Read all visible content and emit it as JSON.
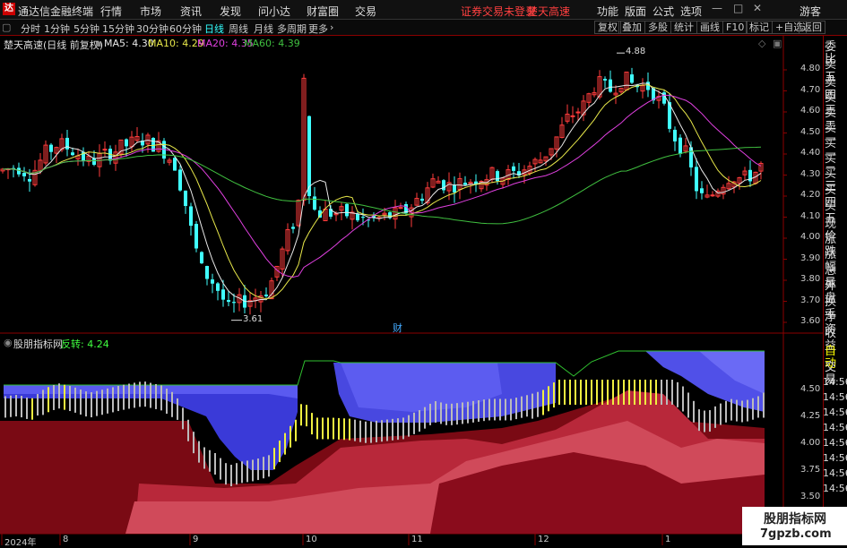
{
  "titlebar": {
    "logo": "达",
    "app_title": "通达信金融终端",
    "menus": [
      "行情",
      "市场",
      "资讯",
      "发现",
      "问小达",
      "财富圈",
      "交易"
    ],
    "warning": "证券交易未登录",
    "stock_name": "楚天高速",
    "right_menus": [
      "功能",
      "版面",
      "公式",
      "选项"
    ],
    "user": "游客"
  },
  "toolbar": {
    "periods": [
      "分时",
      "1分钟",
      "5分钟",
      "15分钟",
      "30分钟",
      "60分钟",
      "日线",
      "周线",
      "月线",
      "多周期",
      "更多"
    ],
    "active_period": "日线",
    "right_buttons": [
      "复权",
      "叠加",
      "多股",
      "统计",
      "画线",
      "F10",
      "标记",
      "+自选",
      "返回"
    ]
  },
  "main_chart": {
    "title": "楚天高速(日线 前复权)",
    "ma": [
      {
        "label": "MA5: 4.30",
        "color": "#e8e8e8"
      },
      {
        "label": "MA10: 4.29",
        "color": "#e8e84a"
      },
      {
        "label": "MA20: 4.35",
        "color": "#e040e0"
      },
      {
        "label": "MA60: 4.39",
        "color": "#40c040"
      }
    ],
    "high_label": "4.88",
    "low_label": "3.61",
    "event_label": "财",
    "y_ticks": [
      "4.80",
      "4.70",
      "4.60",
      "4.50",
      "4.40",
      "4.30",
      "4.20",
      "4.10",
      "4.00",
      "3.90",
      "3.80",
      "3.70",
      "3.60"
    ]
  },
  "sub_chart": {
    "title": "股朋指标网",
    "indicator": "反转: 4.24",
    "indicator_color": "#40ff40",
    "y_ticks": [
      "4.50",
      "4.25",
      "4.00",
      "3.75",
      "3.50"
    ]
  },
  "x_axis": [
    "2024年",
    "8",
    "9",
    "10",
    "11",
    "12",
    "1"
  ],
  "sidebar": [
    "委比",
    "卖五",
    "卖四",
    "卖三",
    "卖二",
    "卖一",
    "买一",
    "买二",
    "买三",
    "买四",
    "买五",
    "现价",
    "涨跌",
    "涨幅",
    "总量",
    "外盘",
    "换手",
    "净资",
    "收益"
  ],
  "sidebar_bottom": [
    "自动",
    "交易"
  ],
  "ticks_times": [
    "14:56",
    "14:56",
    "14:56",
    "14:56",
    "14:56",
    "14:56",
    "14:56",
    "14:56"
  ],
  "watermark": {
    "line1": "股朋指标网",
    "line2": "7gpzb.com"
  },
  "colors": {
    "up": "#ff3c3c",
    "down": "#40ffff",
    "border": "#8b0000"
  }
}
